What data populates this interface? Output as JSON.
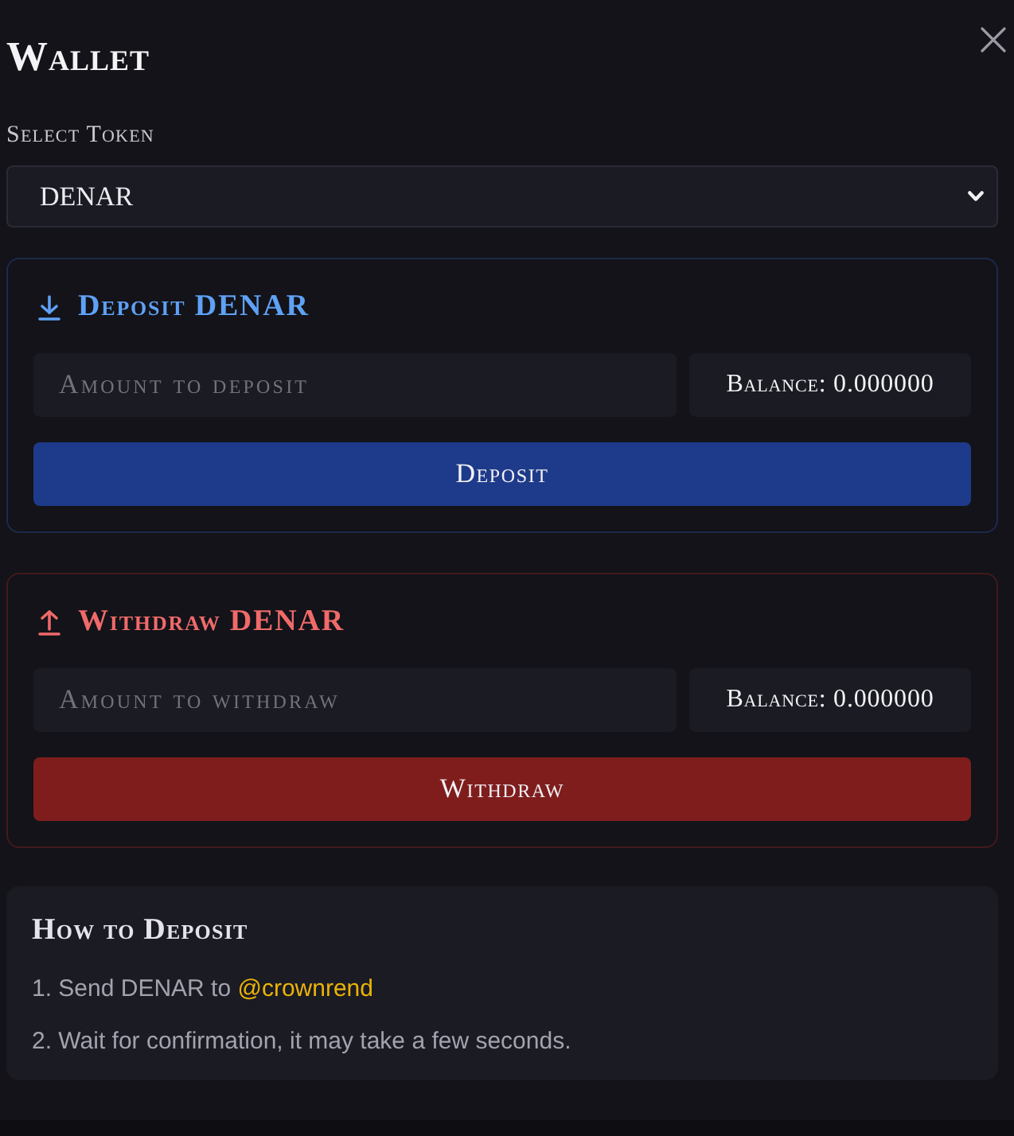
{
  "dialog": {
    "title": "Wallet"
  },
  "token_select": {
    "label": "Select Token",
    "value": "DENAR"
  },
  "sections": [
    {
      "kind": "deposit",
      "title": "Deposit DENAR",
      "placeholder": "Amount to deposit",
      "balance": "Balance: 0.000000",
      "button": "Deposit"
    },
    {
      "kind": "withdraw",
      "title": "Withdraw DENAR",
      "placeholder": "Amount to withdraw",
      "balance": "Balance: 0.000000",
      "button": "Withdraw"
    }
  ],
  "instructions": {
    "title": "How to Deposit",
    "steps": [
      {
        "text": "1. Send DENAR to",
        "link": "@crownrend"
      },
      {
        "text": "2. Wait for confirmation, it may take a few seconds."
      }
    ]
  }
}
